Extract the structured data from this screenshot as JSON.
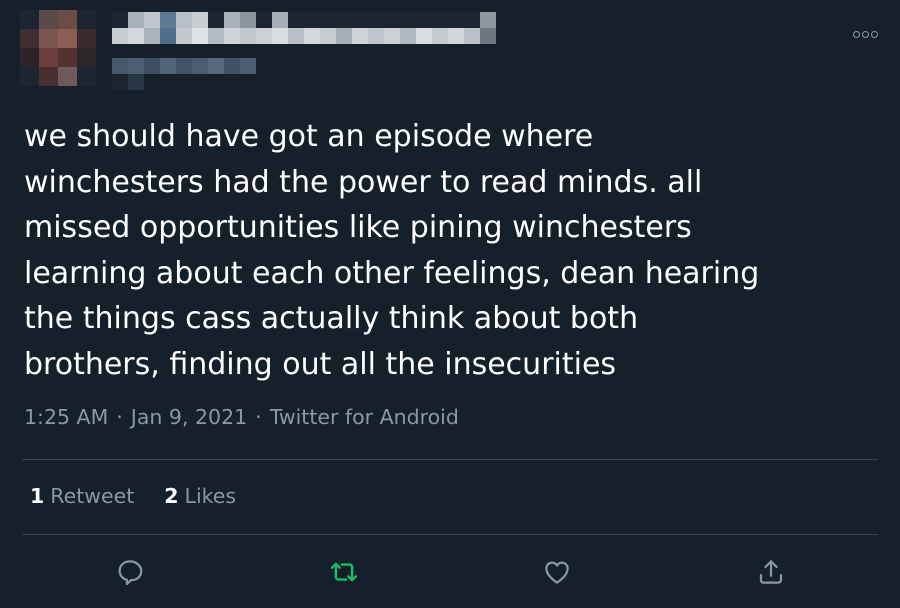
{
  "tweet": {
    "text": "we should have got an episode where\nwinchesters had the power to read minds. all\nmissed opportunities like pining winchesters\nlearning about each other feelings, dean hearing\nthe things cass actually think about both\nbrothers, finding out all the insecurities",
    "time": "1:25 AM",
    "separator": "·",
    "date": "Jan 9, 2021",
    "source": "Twitter for Android"
  },
  "stats": {
    "retweets_count": "1",
    "retweets_label": "Retweet",
    "likes_count": "2",
    "likes_label": "Likes"
  },
  "actions": {
    "reply_icon": "reply-icon",
    "retweet_icon": "retweet-icon",
    "like_icon": "heart-icon",
    "share_icon": "share-icon",
    "retweet_active_color": "#17bf63"
  },
  "colors": {
    "background": "#15202b",
    "text": "#ffffff",
    "secondary_text": "#8899a6",
    "divider": "#38444d"
  }
}
